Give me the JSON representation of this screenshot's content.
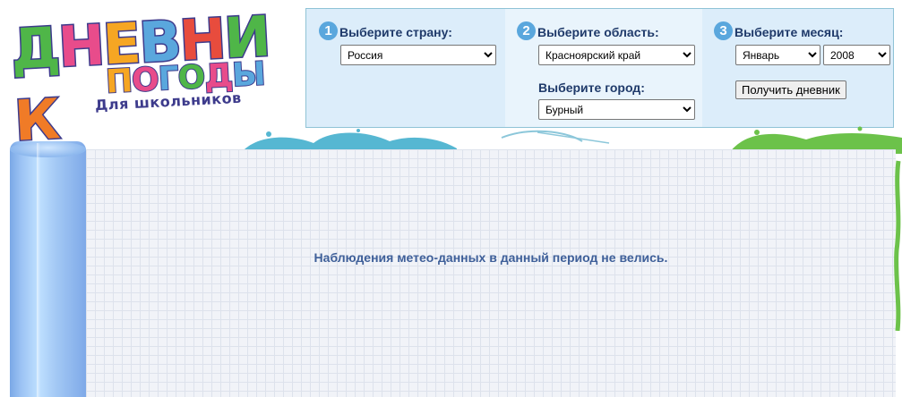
{
  "logo": {
    "word1_letters": [
      "Д",
      "Н",
      "Е",
      "В",
      "Н",
      "И",
      "К"
    ],
    "word1_colors": [
      "#4fb648",
      "#e84c8b",
      "#f6a623",
      "#5aa7dd",
      "#e84c3d",
      "#4fb648",
      "#f07b27"
    ],
    "word2_letters": [
      "П",
      "О",
      "Г",
      "О",
      "Д",
      "Ы"
    ],
    "word2_colors": [
      "#f6a623",
      "#e84c8b",
      "#5aa7dd",
      "#4fb648",
      "#e84c8b",
      "#5aa7dd"
    ],
    "subtitle": "Для школьников"
  },
  "step1": {
    "number": "1",
    "label": "Выберите страну:",
    "country": "Россия"
  },
  "step2": {
    "number": "2",
    "label": "Выберите область:",
    "region": "Красноярский край",
    "city_label": "Выберите город:",
    "city": "Бурный"
  },
  "step3": {
    "number": "3",
    "label": "Выберите месяц:",
    "month": "Январь",
    "year": "2008",
    "button": "Получить дневник"
  },
  "message": "Наблюдения метео-данных в данный период не велись.",
  "colors": {
    "panel_bg": "#dcedfa",
    "panel_border": "#8fc3d6",
    "step_badge": "#5aa7dd",
    "label_text": "#1f3a6a",
    "message_text": "#3e5f99",
    "paper_bg": "#f1f3f8"
  }
}
